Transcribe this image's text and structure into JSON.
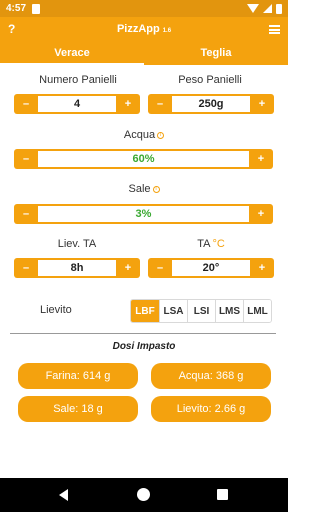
{
  "status": {
    "time": "4:57"
  },
  "app": {
    "help": "?",
    "title": "PizzApp",
    "version": "1.6"
  },
  "tabs": [
    {
      "label": "Verace"
    },
    {
      "label": "Teglia"
    }
  ],
  "controls": {
    "numero_panielli": {
      "label": "Numero Panielli",
      "value": "4",
      "minus": "–",
      "plus": "+"
    },
    "peso_panielli": {
      "label": "Peso Panielli",
      "value": "250g",
      "minus": "–",
      "plus": "+"
    },
    "acqua": {
      "label": "Acqua",
      "value": "60%",
      "minus": "–",
      "plus": "+"
    },
    "sale": {
      "label": "Sale",
      "value": "3%",
      "minus": "–",
      "plus": "+"
    },
    "liev_ta": {
      "label": "Liev. TA",
      "value": "8h",
      "minus": "–",
      "plus": "+"
    },
    "ta": {
      "label": "TA",
      "unit": "°C",
      "value": "20°",
      "minus": "–",
      "plus": "+"
    }
  },
  "lievito": {
    "label": "Lievito",
    "options": [
      "LBF",
      "LSA",
      "LSI",
      "LMS",
      "LML"
    ],
    "selected": "LBF"
  },
  "dosi": {
    "title": "Dosi Impasto",
    "farina": "Farina: 614 g",
    "acqua": "Acqua: 368 g",
    "sale": "Sale: 18 g",
    "lievito": "Lievito: 2.66 g"
  },
  "colors": {
    "accent": "#f4a20e",
    "statusbar": "#e2950e",
    "value_green": "#3aa832"
  }
}
